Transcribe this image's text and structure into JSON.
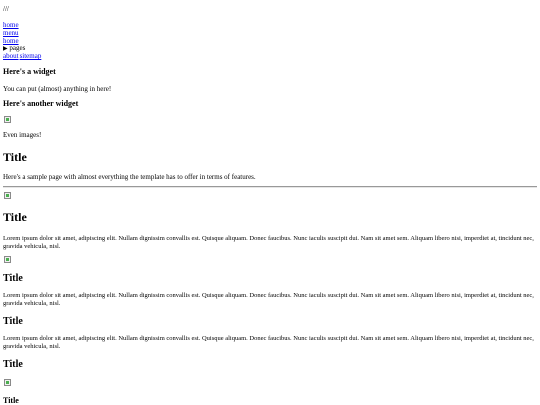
{
  "top_text": "///",
  "nav": {
    "links": [
      "home",
      "menu",
      "home"
    ],
    "pages_label": "pages",
    "bottom_links": [
      "about",
      "sitemap"
    ]
  },
  "widgets": [
    {
      "title": "Here's a widget",
      "text": "You can put (almost) anything in here!"
    },
    {
      "title": "Here's another widget",
      "text": "Even images!"
    }
  ],
  "intro": {
    "title": "Title",
    "text": "Here's a sample page with almost everything the template has to offer in terms of features."
  },
  "sections": [
    {
      "title": "Title",
      "text": "Lorem ipsum dolor sit amet, adipiscing elit. Nullam dignissim convallis est. Quisque aliquam. Donec faucibus. Nunc iaculis suscipit dui. Nam sit amet sem. Aliquam libero nisi, imperdiet at, tincidunt nec, gravida vehicula, nisl."
    },
    {
      "title": "Title",
      "text": "Lorem ipsum dolor sit amet, adipiscing elit. Nullam dignissim convallis est. Quisque aliquam. Donec faucibus. Nunc iaculis suscipit dui. Nam sit amet sem. Aliquam libero nisi, imperdiet at, tincidunt nec, gravida vehicula, nisl."
    },
    {
      "title": "Title",
      "text": "Lorem ipsum dolor sit amet, adipiscing elit. Nullam dignissim convallis est. Quisque aliquam. Donec faucibus. Nunc iaculis suscipit dui. Nam sit amet sem. Aliquam libero nisi, imperdiet at, tincidunt nec, gravida vehicula, nisl."
    },
    {
      "title": "Title"
    },
    {
      "title": "Title"
    }
  ]
}
